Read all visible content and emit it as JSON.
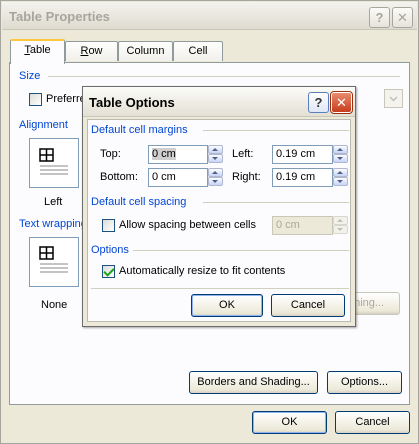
{
  "window": {
    "title": "Table Properties",
    "help_glyph": "?",
    "close_glyph": "✕"
  },
  "tabs": [
    {
      "label": "Table",
      "mnemonic": "T",
      "rest": "able"
    },
    {
      "label": "Row",
      "mnemonic": "R",
      "rest": "ow"
    },
    {
      "label": "Column",
      "mnemonic": "U",
      "pre": "Col",
      "post": "mn"
    },
    {
      "label": "Cell",
      "mnemonic": "E",
      "pre": "C",
      "post": "ll"
    }
  ],
  "size": {
    "section_label": "Size",
    "preferred_label": "Preferre"
  },
  "alignment": {
    "section_label": "Alignment",
    "left_label": "Left"
  },
  "text_wrapping": {
    "section_label": "Text wrapping",
    "none_label": "None"
  },
  "positioning_button": "oning...",
  "borders_button": "Borders and Shading...",
  "options_button": "Options...",
  "ok_button": "OK",
  "cancel_button": "Cancel",
  "table_options": {
    "title": "Table Options",
    "margins_section": "Default cell margins",
    "top_label": "Top:",
    "top_value": "0 cm",
    "left_label": "Left:",
    "left_value": "0.19 cm",
    "bottom_label": "Bottom:",
    "bottom_value": "0 cm",
    "right_label": "Right:",
    "right_value": "0.19 cm",
    "spacing_section": "Default cell spacing",
    "allow_spacing_label": "Allow spacing between cells",
    "allow_spacing_checked": false,
    "spacing_value": "0 cm",
    "options_section": "Options",
    "auto_resize_label": "Automatically resize to fit contents",
    "auto_resize_checked": true,
    "ok_label": "OK",
    "cancel_label": "Cancel"
  }
}
